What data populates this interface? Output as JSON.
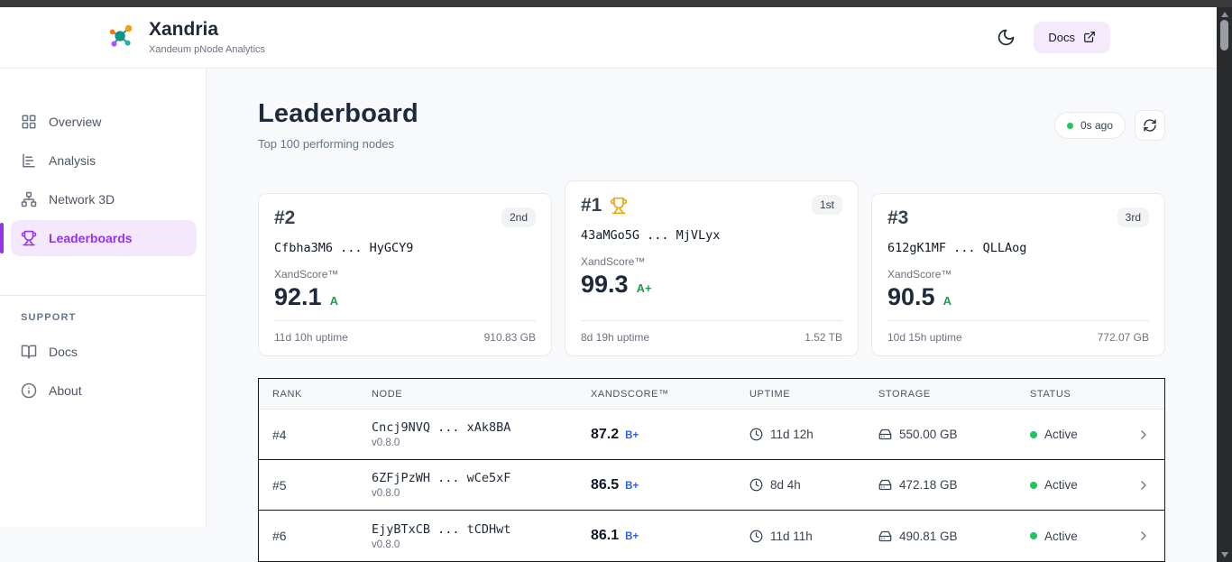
{
  "header": {
    "app_name": "Xandria",
    "app_subtitle": "Xandeum pNode Analytics",
    "docs_button": "Docs",
    "icons": [
      "moon-icon",
      "external-link-icon",
      "network-logo-icon"
    ]
  },
  "sidebar": {
    "items": [
      {
        "label": "Overview",
        "icon": "layout-grid-icon",
        "active": false
      },
      {
        "label": "Analysis",
        "icon": "bar-chart-icon",
        "active": false
      },
      {
        "label": "Network 3D",
        "icon": "network-icon",
        "active": false
      },
      {
        "label": "Leaderboards",
        "icon": "trophy-icon",
        "active": true
      }
    ],
    "support_label": "SUPPORT",
    "support_items": [
      {
        "label": "Docs",
        "icon": "book-open-icon"
      },
      {
        "label": "About",
        "icon": "info-icon"
      }
    ]
  },
  "main": {
    "title": "Leaderboard",
    "subtitle": "Top 100 performing nodes",
    "last_refresh": "0s ago",
    "refresh_icon": "refresh-icon"
  },
  "podium": [
    {
      "rank": "#2",
      "badge": "2nd",
      "node": "Cfbha3M6 ... HyGCY9",
      "score_label": "XandScore™",
      "score": "92.1",
      "grade": "A",
      "uptime": "11d 10h uptime",
      "storage": "910.83 GB"
    },
    {
      "rank": "#1",
      "badge": "1st",
      "node": "43aMGo5G ... MjVLyx",
      "score_label": "XandScore™",
      "score": "99.3",
      "grade": "A+",
      "uptime": "8d 19h uptime",
      "storage": "1.52 TB",
      "trophy": true
    },
    {
      "rank": "#3",
      "badge": "3rd",
      "node": "612gK1MF ... QLLAog",
      "score_label": "XandScore™",
      "score": "90.5",
      "grade": "A",
      "uptime": "10d 15h uptime",
      "storage": "772.07 GB"
    }
  ],
  "table": {
    "columns": [
      "RANK",
      "NODE",
      "XANDSCORE™",
      "UPTIME",
      "STORAGE",
      "STATUS"
    ],
    "rows": [
      {
        "rank": "#4",
        "node": "Cncj9NVQ ... xAk8BA",
        "version": "v0.8.0",
        "score": "87.2",
        "grade": "B+",
        "uptime": "11d 12h",
        "storage": "550.00 GB",
        "status": "Active"
      },
      {
        "rank": "#5",
        "node": "6ZFjPzWH ... wCe5xF",
        "version": "v0.8.0",
        "score": "86.5",
        "grade": "B+",
        "uptime": "8d 4h",
        "storage": "472.18 GB",
        "status": "Active"
      },
      {
        "rank": "#6",
        "node": "EjyBTxCB ... tCDHwt",
        "version": "v0.8.0",
        "score": "86.1",
        "grade": "B+",
        "uptime": "11d 11h",
        "storage": "490.81 GB",
        "status": "Active"
      }
    ]
  },
  "colors": {
    "accent_purple": "#9333ea",
    "accent_purple_bg": "#f3e8fc",
    "grade_green": "#16a34a",
    "grade_blue": "#2563eb",
    "status_green": "#22c55e",
    "trophy_gold": "#eaa70c",
    "topbar_dark": "#3a3a3c"
  }
}
